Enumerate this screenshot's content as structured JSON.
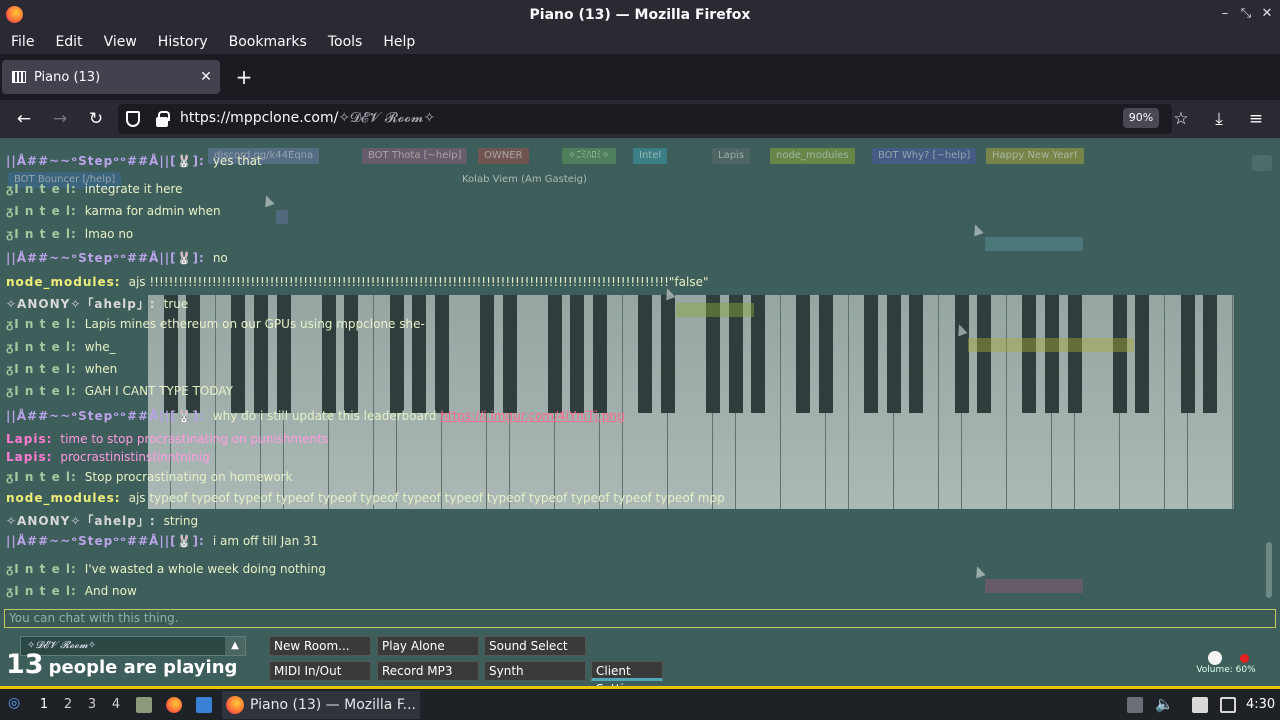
{
  "window": {
    "title": "Piano (13) — Mozilla Firefox"
  },
  "menu": [
    "File",
    "Edit",
    "View",
    "History",
    "Bookmarks",
    "Tools",
    "Help"
  ],
  "tab": {
    "title": "Piano (13)"
  },
  "nav": {
    "url_host": "https://mppclone.com/",
    "url_path": "✧𝓓𝓔𝓥 𝓡𝓸𝓸𝓶✧",
    "zoom": "90%"
  },
  "chat": [
    {
      "nick": "||Å##~~ᵒStepᵒᵒ##Å||[🐰]:",
      "msg": "yes that",
      "nickColor": "#b9a4e8"
    },
    {
      "nick": "ᵹI n t e l:",
      "msg": "integrate it here",
      "nickColor": "#a6c8a0"
    },
    {
      "nick": "ᵹI n t e l:",
      "msg": "karma for admin when",
      "nickColor": "#a6c8a0"
    },
    {
      "nick": "ᵹI n t e l:",
      "msg": "lmao no",
      "nickColor": "#a6c8a0"
    },
    {
      "nick": "||Å##~~ᵒStepᵒᵒ##Å||[🐰]:",
      "msg": "no",
      "nickColor": "#b9a4e8"
    },
    {
      "nick": "node_modules:",
      "msg": "ajs !!!!!!!!!!!!!!!!!!!!!!!!!!!!!!!!!!!!!!!!!!!!!!!!!!!!!!!!!!!!!!!!!!!!!!!!!!!!!!!!!!!!!!!!!!!!!!!!!!!!!!!!!!!!\"false\"",
      "nickColor": "#f0f07a"
    },
    {
      "nick": "✧ANONY✧「ahelp」:",
      "msg": "true",
      "nickColor": "#d8d8d8"
    },
    {
      "nick": "ᵹI n t e l:",
      "msg": "Lapis mines ethereum on our GPUs using mppclone she-",
      "nickColor": "#a6c8a0"
    },
    {
      "nick": "ᵹI n t e l:",
      "msg": "whe_",
      "nickColor": "#a6c8a0"
    },
    {
      "nick": "ᵹI n t e l:",
      "msg": "when",
      "nickColor": "#a6c8a0"
    },
    {
      "nick": "ᵹI n t e l:",
      "msg": "GAH I CANT TYPE TODAY",
      "nickColor": "#a6c8a0"
    },
    {
      "nick": "||Å##~~ᵒStepᵒᵒ##Å||[🐰]:",
      "msg": "why do i still update this leaderboard",
      "link": "https://i.imgur.com/4iYniTj.png",
      "nickColor": "#b9a4e8"
    },
    {
      "nick": "Lapis:",
      "msg": "time to stop procrastinating on punishments",
      "nickColor": "#ff7ad0",
      "msgColor": "#ff9ae0"
    },
    {
      "nick": "Lapis:",
      "msg": "procrastinistinstinntninig",
      "nickColor": "#ff7ad0",
      "msgColor": "#ff9ae0"
    },
    {
      "nick": "ᵹI n t e l:",
      "msg": "Stop procrastinating on homework",
      "nickColor": "#a6c8a0"
    },
    {
      "nick": "node_modules:",
      "msg": "ajs typeof typeof typeof typeof typeof typeof typeof typeof typeof typeof typeof typeof typeof mpp",
      "nickColor": "#f0f07a"
    },
    {
      "nick": "✧ANONY✧「ahelp」:",
      "msg": "string",
      "nickColor": "#d8d8d8"
    },
    {
      "nick": "||Å##~~ᵒStepᵒᵒ##Å||[🐰]:",
      "msg": "i am off till Jan 31",
      "nickColor": "#b9a4e8"
    },
    {
      "nick": "ᵹI n t e l:",
      "msg": "I've wasted a whole week doing nothing",
      "nickColor": "#a6c8a0"
    },
    {
      "nick": "ᵹI n t e l:",
      "msg": "And now",
      "nickColor": "#a6c8a0"
    }
  ],
  "chat_placeholder": "You can chat with this thing.",
  "users": [
    {
      "name": "discord.gg/k44Eqna",
      "color": "#6a7aa8"
    },
    {
      "name": "BOT Thota [~help]",
      "color": "#8a5b7a"
    },
    {
      "name": "OWNER",
      "color": "#9a4e4e"
    },
    {
      "name": "✧ﾆﾐﾊﾛﾐ✧",
      "color": "#5a9a5a"
    },
    {
      "name": "Intel",
      "color": "#3a9aa8"
    },
    {
      "name": "Lapis",
      "color": "#5c6e6c"
    },
    {
      "name": "node_modules",
      "color": "#8aa83a"
    },
    {
      "name": "BOT Why? [~help]",
      "color": "#4a5aa8"
    },
    {
      "name": "Happy New Year!",
      "color": "#a8a83a"
    },
    {
      "name": "BOT Bouncer [/help]",
      "color": "#3a6a9a"
    },
    {
      "name": "Kolab Viem (Am Gasteig)",
      "color": "transparent"
    }
  ],
  "room": {
    "name": "✧𝓓𝓔𝓥 𝓡𝓸𝓸𝓶✧",
    "count": "13",
    "count_label": "people are playing"
  },
  "buttons": {
    "new_room": "New Room...",
    "play_alone": "Play Alone",
    "sound_select": "Sound Select",
    "midi": "MIDI In/Out",
    "record": "Record MP3",
    "synth": "Synth",
    "client_settings": "Client Settings"
  },
  "volume": "Volume: 60%",
  "taskbar": {
    "workspaces": [
      "1",
      "2",
      "3",
      "4"
    ],
    "window": "Piano (13) — Mozilla F...",
    "clock": "4:30"
  }
}
